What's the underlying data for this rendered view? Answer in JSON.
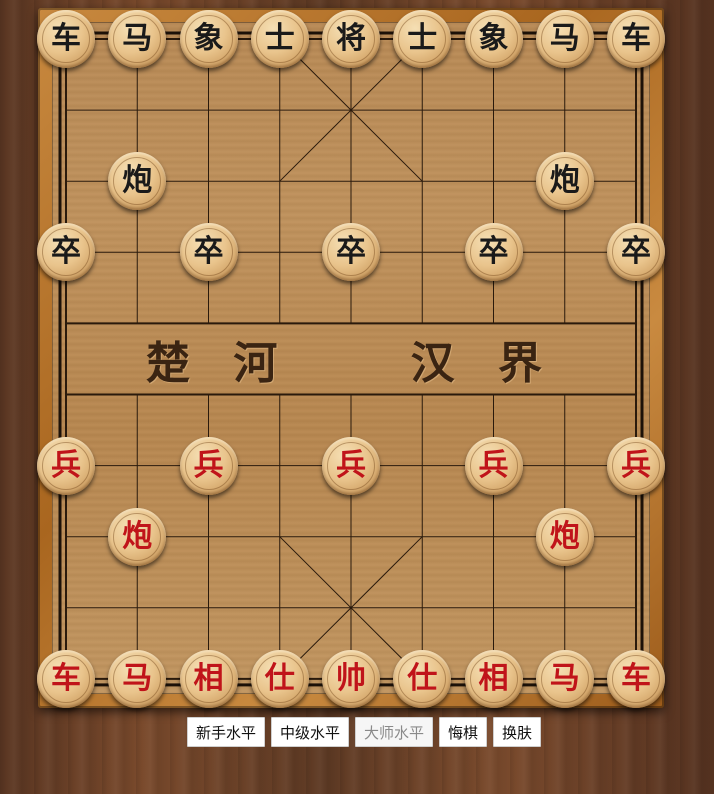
{
  "board": {
    "river_left": "楚 河",
    "river_right": "汉 界"
  },
  "pieces": [
    {
      "id": "b-che-1",
      "label": "车",
      "side": "black",
      "col": 0,
      "row": 0
    },
    {
      "id": "b-ma-1",
      "label": "马",
      "side": "black",
      "col": 1,
      "row": 0
    },
    {
      "id": "b-xiang-1",
      "label": "象",
      "side": "black",
      "col": 2,
      "row": 0
    },
    {
      "id": "b-shi-1",
      "label": "士",
      "side": "black",
      "col": 3,
      "row": 0
    },
    {
      "id": "b-jiang",
      "label": "将",
      "side": "black",
      "col": 4,
      "row": 0
    },
    {
      "id": "b-shi-2",
      "label": "士",
      "side": "black",
      "col": 5,
      "row": 0
    },
    {
      "id": "b-xiang-2",
      "label": "象",
      "side": "black",
      "col": 6,
      "row": 0
    },
    {
      "id": "b-ma-2",
      "label": "马",
      "side": "black",
      "col": 7,
      "row": 0
    },
    {
      "id": "b-che-2",
      "label": "车",
      "side": "black",
      "col": 8,
      "row": 0
    },
    {
      "id": "b-pao-1",
      "label": "炮",
      "side": "black",
      "col": 1,
      "row": 2
    },
    {
      "id": "b-pao-2",
      "label": "炮",
      "side": "black",
      "col": 7,
      "row": 2
    },
    {
      "id": "b-zu-1",
      "label": "卒",
      "side": "black",
      "col": 0,
      "row": 3
    },
    {
      "id": "b-zu-2",
      "label": "卒",
      "side": "black",
      "col": 2,
      "row": 3
    },
    {
      "id": "b-zu-3",
      "label": "卒",
      "side": "black",
      "col": 4,
      "row": 3
    },
    {
      "id": "b-zu-4",
      "label": "卒",
      "side": "black",
      "col": 6,
      "row": 3
    },
    {
      "id": "b-zu-5",
      "label": "卒",
      "side": "black",
      "col": 8,
      "row": 3
    },
    {
      "id": "r-bing-1",
      "label": "兵",
      "side": "red",
      "col": 0,
      "row": 6
    },
    {
      "id": "r-bing-2",
      "label": "兵",
      "side": "red",
      "col": 2,
      "row": 6
    },
    {
      "id": "r-bing-3",
      "label": "兵",
      "side": "red",
      "col": 4,
      "row": 6
    },
    {
      "id": "r-bing-4",
      "label": "兵",
      "side": "red",
      "col": 6,
      "row": 6
    },
    {
      "id": "r-bing-5",
      "label": "兵",
      "side": "red",
      "col": 8,
      "row": 6
    },
    {
      "id": "r-pao-1",
      "label": "炮",
      "side": "red",
      "col": 1,
      "row": 7
    },
    {
      "id": "r-pao-2",
      "label": "炮",
      "side": "red",
      "col": 7,
      "row": 7
    },
    {
      "id": "r-che-1",
      "label": "车",
      "side": "red",
      "col": 0,
      "row": 9
    },
    {
      "id": "r-ma-1",
      "label": "马",
      "side": "red",
      "col": 1,
      "row": 9
    },
    {
      "id": "r-xiang-1",
      "label": "相",
      "side": "red",
      "col": 2,
      "row": 9
    },
    {
      "id": "r-shi-1",
      "label": "仕",
      "side": "red",
      "col": 3,
      "row": 9
    },
    {
      "id": "r-shuai",
      "label": "帅",
      "side": "red",
      "col": 4,
      "row": 9
    },
    {
      "id": "r-shi-2",
      "label": "仕",
      "side": "red",
      "col": 5,
      "row": 9
    },
    {
      "id": "r-xiang-2",
      "label": "相",
      "side": "red",
      "col": 6,
      "row": 9
    },
    {
      "id": "r-ma-2",
      "label": "马",
      "side": "red",
      "col": 7,
      "row": 9
    },
    {
      "id": "r-che-2",
      "label": "车",
      "side": "red",
      "col": 8,
      "row": 9
    }
  ],
  "controls": {
    "beginner": "新手水平",
    "intermediate": "中级水平",
    "master": "大师水平",
    "undo": "悔棋",
    "skin": "换肤"
  }
}
